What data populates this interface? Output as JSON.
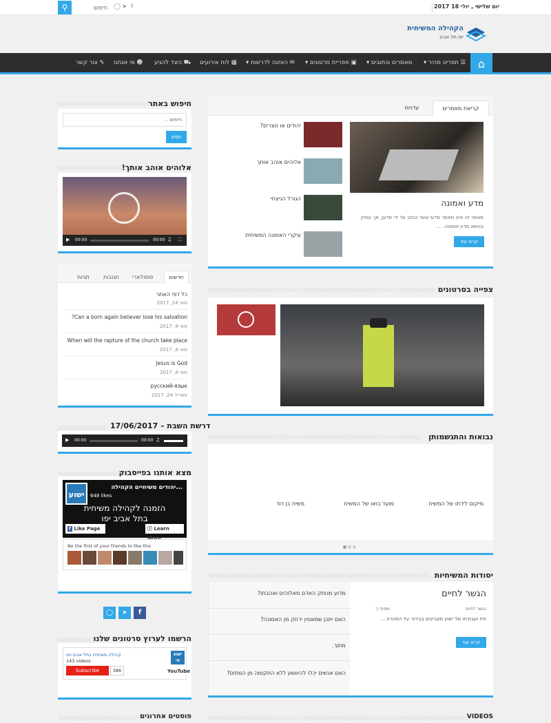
{
  "topbar": {
    "date": "יום שלישי , יולי 18 2017",
    "search_placeholder": "חיפוש",
    "search_icon": "search-icon"
  },
  "logo": {
    "title": "הקהילה המשיחית",
    "subtitle": "יפו תל אביב"
  },
  "nav": {
    "items": [
      "תפריט מהיר ▾",
      "מאמרים וכתובים ▾",
      "ספריית סרטונים ▾",
      "האזנה לדרשות ▾",
      "לוח אירועים",
      "כיצד להגיע",
      "מי אנחנו",
      "צור קשר"
    ]
  },
  "main": {
    "tabs": [
      "קריאת מאמרים",
      "עדויות"
    ],
    "feature": {
      "title": "מדע ואמונה",
      "excerpt": "מאמר זה אינו מאמר מדעי אשר נכתב על ידי מדען, אך עוסק בנושא מדע ואמונה. ...",
      "button": "קרא עוד"
    },
    "articles": [
      "יהודים או נוצרים?",
      "אלוהים אוהב אותך",
      "הגורל הניצחי",
      "עיקרי האמונה המשיחית"
    ],
    "videos_heading": "צפייה בסרטונים",
    "prophecies_heading": "נבואות והתגשמותן",
    "prophecies": [
      "מיקום לידתו של המשיח",
      "מועד בואו של המשיח",
      "משיח בן דוד"
    ],
    "foundations_heading": "יסודות המשיחיות",
    "foundation_feature": {
      "title": "הגשר לחיים",
      "meta_left": "מוסיף ג'",
      "meta_right": "הגשר לחיים",
      "excerpt": "חייו ועבודתו של ישוע מצביעים בבירור על המטרה ...",
      "button": "קרא עוד"
    },
    "foundation_list": [
      "מדוע מנותק האדם מאלוהים ואהבתו?",
      "האם יתכן שמאמין ירחק מן האמונה?",
      "מתוך.",
      "האם אנשים יכלו להיוושע ללא התקומה מן המתים?"
    ],
    "videos_footer": "VIDEOS"
  },
  "sidebar": {
    "search_heading": "חיפוש באתר",
    "search_placeholder": "חיפוש ...",
    "search_button": "חפש",
    "video_heading": "אלוהים אוהב אותך!",
    "video_time": "00:00",
    "video_time2": "00:00",
    "tabs": [
      "חדשים",
      "פופולארי",
      "תגובות",
      "תגיות"
    ],
    "recent": [
      {
        "title": "כל דפי האתר",
        "date": "מאי 14, 2017"
      },
      {
        "title": "?Can a born again believer lose his salvation",
        "date": "מאי 4, 2017"
      },
      {
        "title": "When will the rapture of the church take place",
        "date": "מאי 4, 2017"
      },
      {
        "title": "Jesus is God",
        "date": "מאי 4, 2017"
      },
      {
        "title": "русский-язык",
        "date": "אפריל 24, 2017"
      }
    ],
    "sermon_heading": "דרשת השבת – 17/06/2017",
    "audio_time": "00:00",
    "audio_time2": "00:00",
    "facebook_heading": "מצא אותנו בפייסבוק",
    "fb": {
      "page": "...יהודים משיחיים הקהילה",
      "likes": "648 likes",
      "logo": "ישוע",
      "banner": "הזמנה לקהילה משיחית בתל אביב יפו",
      "like_btn": "Like Page",
      "learn_btn": "Learn More",
      "friends": "Be the first of your friends to like this"
    },
    "youtube_heading": "הרשמו לערוץ סרטונים שלנו",
    "yt": {
      "channel": "קהילה משיחית בתל אביב-יפו",
      "videos": "143 videos",
      "subscribe": "Subscribe",
      "count": "386",
      "logo": "ישוע חי",
      "brand": "YouTube"
    },
    "recent_posts_heading": "פוסטים אחרונים"
  },
  "colors": {
    "accent": "#32a8e8",
    "nav": "#2d2d2d"
  }
}
